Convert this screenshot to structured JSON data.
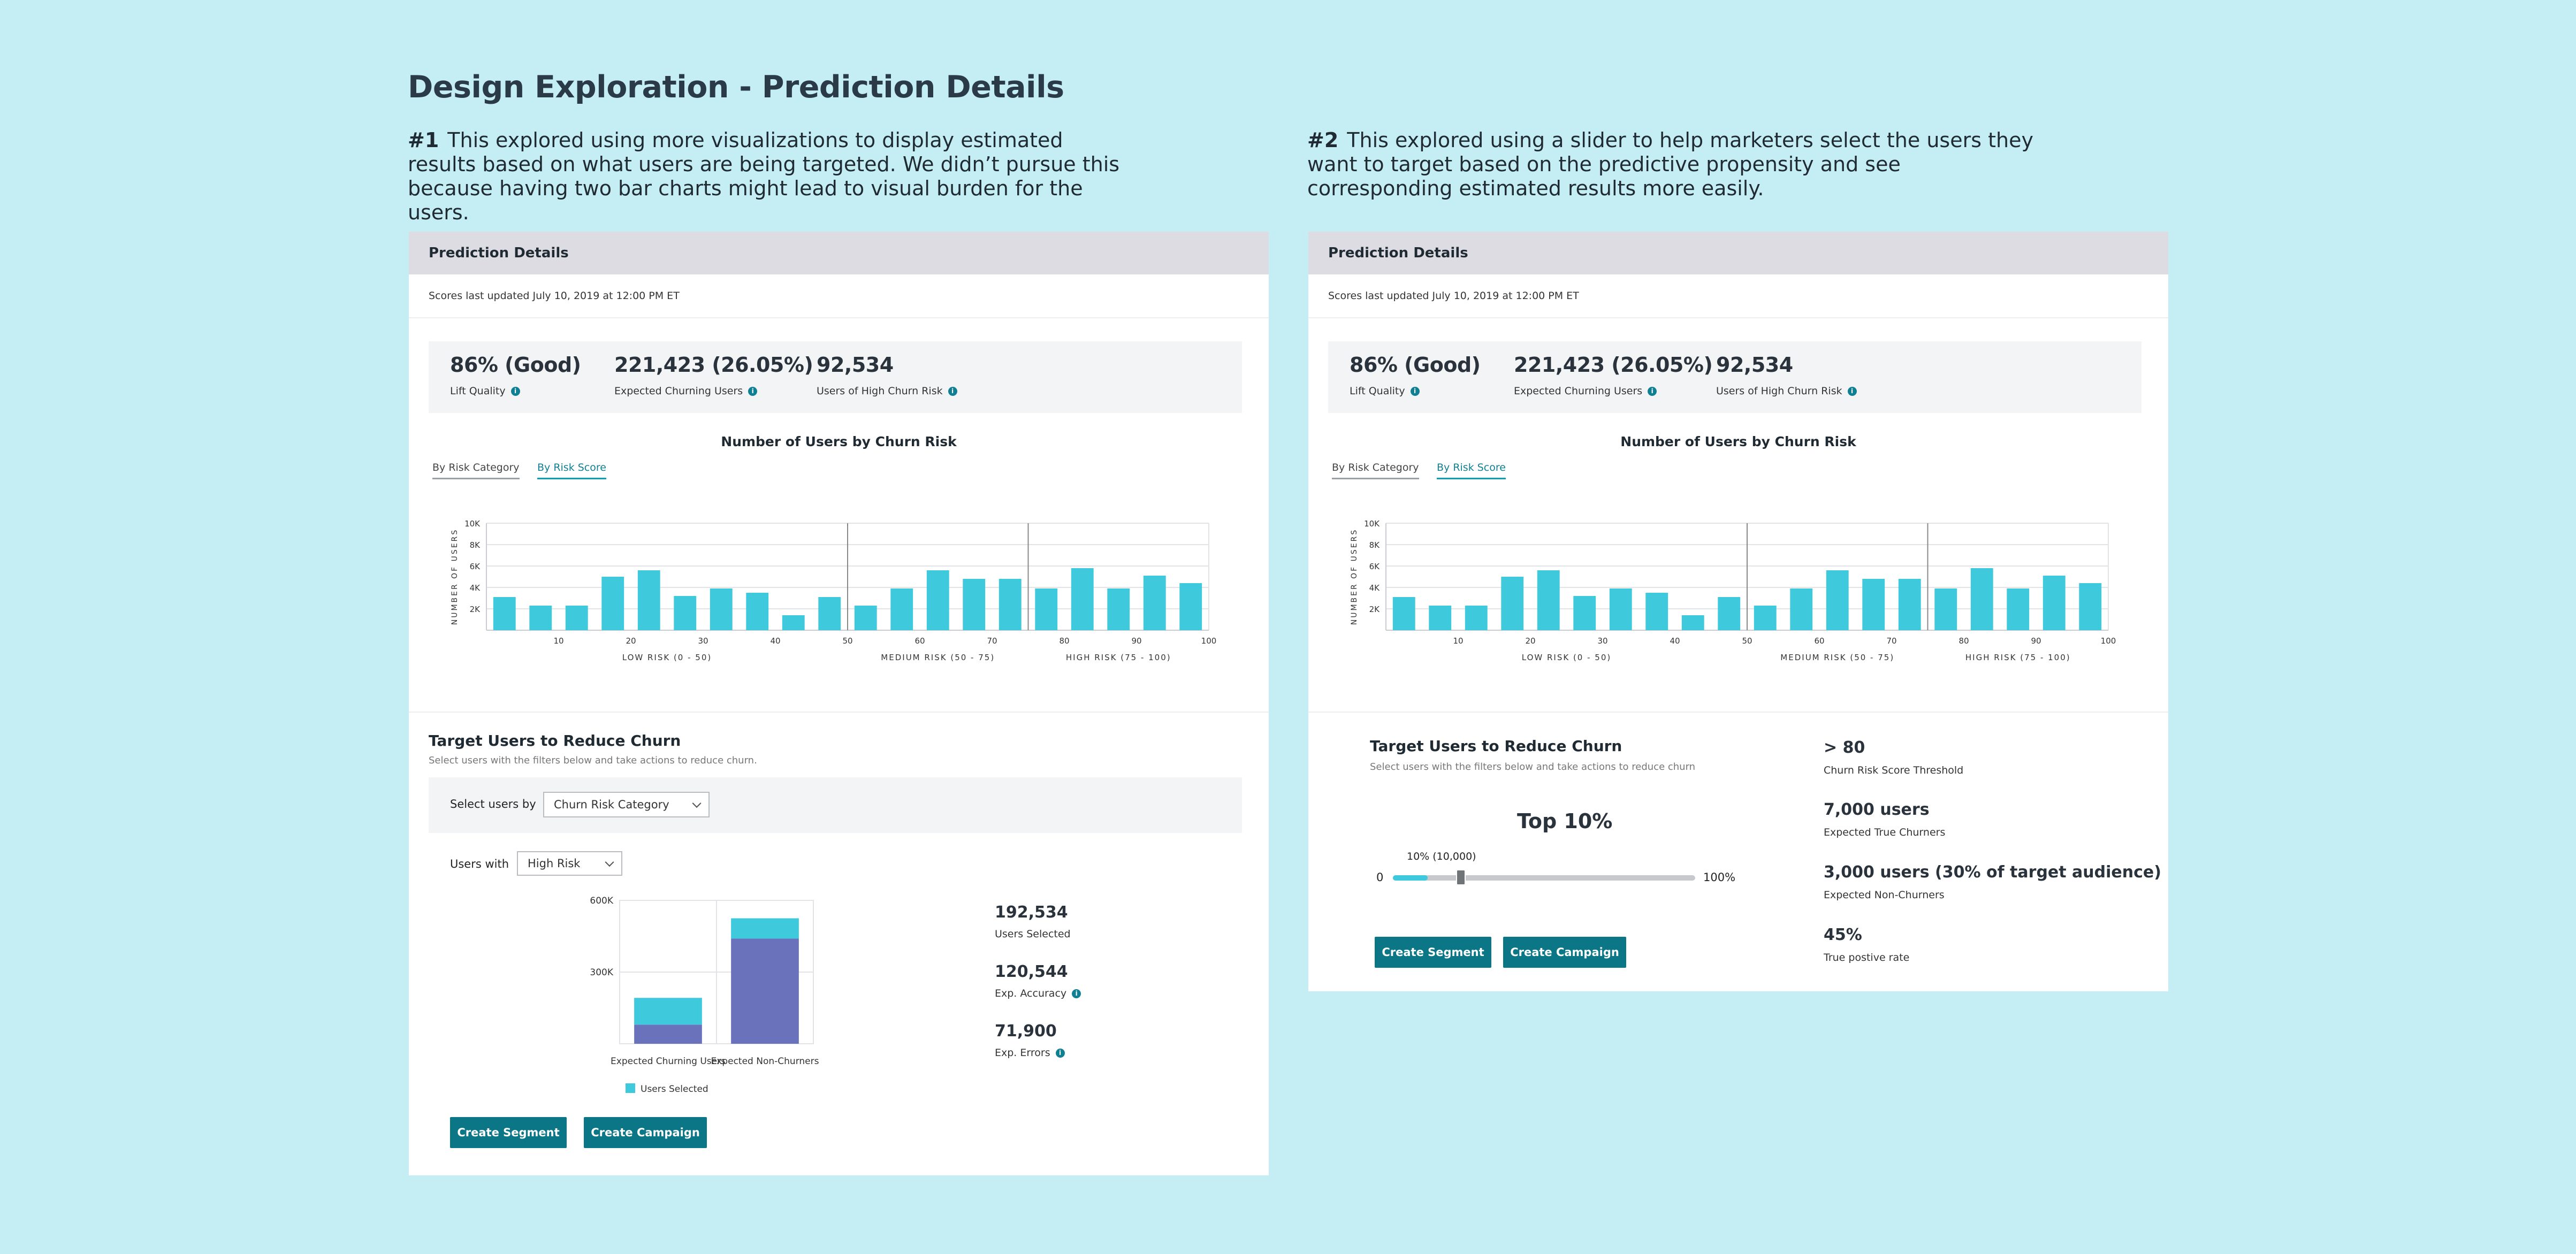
{
  "page": {
    "title": "Design Exploration - Prediction Details",
    "explorations": [
      {
        "number": "#1",
        "text": "This explored using more visualizations to display estimated results based on what users are being targeted. We didn’t pursue this because having two bar charts might lead to visual burden for the users."
      },
      {
        "number": "#2",
        "text": "This explored using a slider to help marketers select the users they want to target based on the predictive propensity and see corresponding estimated results more easily."
      }
    ]
  },
  "panel": {
    "header": "Prediction Details",
    "updated": "Scores last updated July 10, 2019 at 12:00 PM ET",
    "metrics": [
      {
        "value": "86% (Good)",
        "label": "Lift Quality"
      },
      {
        "value": "221,423 (26.05%)",
        "label": "Expected Churning Users"
      },
      {
        "value": "92,534",
        "label": "Users of High Churn Risk"
      }
    ],
    "tabs": [
      "By Risk Category",
      "By Risk Score"
    ],
    "info_icon": "i"
  },
  "chart_data": [
    {
      "type": "bar",
      "title": "Number of Users by Churn Risk",
      "ylabel": "NUMBER OF USERS",
      "ylim": [
        0,
        10000
      ],
      "yticks": [
        "2K",
        "4K",
        "6K",
        "8K",
        "10K"
      ],
      "xticks": [
        "10",
        "20",
        "30",
        "40",
        "50",
        "60",
        "70",
        "80",
        "90",
        "100"
      ],
      "categories": [
        "5",
        "10",
        "15",
        "20",
        "25",
        "30",
        "35",
        "40",
        "45",
        "50",
        "55",
        "60",
        "65",
        "70",
        "75",
        "80",
        "85",
        "90",
        "95",
        "100"
      ],
      "values": [
        3100,
        2300,
        2300,
        5000,
        5600,
        3200,
        3900,
        3500,
        1400,
        3100,
        2300,
        3900,
        5600,
        4800,
        4800,
        3900,
        5800,
        3900,
        5100,
        4400
      ],
      "segments": [
        "LOW RISK (0 - 50)",
        "MEDIUM RISK (50 - 75)",
        "HIGH RISK (75 - 100)"
      ],
      "color": "#3ec9dd"
    },
    {
      "type": "bar",
      "stacked": true,
      "categories": [
        "Expected Churning Users",
        "Expected Non-Churners"
      ],
      "series": [
        {
          "name": "",
          "values": [
            80000,
            440000
          ],
          "color": "#6a72bc"
        },
        {
          "name": "Users Selected",
          "values": [
            112000,
            85000
          ],
          "color": "#3ec9dd"
        }
      ],
      "ylim": [
        0,
        600000
      ],
      "yticks": [
        "300K",
        "600K"
      ]
    }
  ],
  "left": {
    "target": {
      "title": "Target Users to Reduce Churn",
      "subtitle": "Select users with the filters below and take actions to reduce churn.",
      "select_by_label": "Select users by",
      "select_by_value": "Churn Risk Category",
      "users_with_label": "Users with",
      "users_with_value": "High Risk"
    },
    "stats": [
      {
        "value": "192,534",
        "label": "Users Selected",
        "info": false
      },
      {
        "value": "120,544",
        "label": "Exp. Accuracy",
        "info": true
      },
      {
        "value": "71,900",
        "label": "Exp. Errors",
        "info": true
      }
    ],
    "buttons": {
      "segment": "Create Segment",
      "campaign": "Create Campaign"
    }
  },
  "right": {
    "target": {
      "title": "Target Users to Reduce Churn",
      "subtitle": "Select users with the filters below and take actions to reduce churn"
    },
    "slider": {
      "title": "Top 10%",
      "value_label": "10% (10,000)",
      "min_label": "0",
      "max_label": "100%",
      "value": 0.1
    },
    "stats": [
      {
        "value": "> 80",
        "label": "Churn Risk Score Threshold"
      },
      {
        "value": "7,000 users",
        "label": "Expected True Churners"
      },
      {
        "value": "3,000 users (30% of target audience)",
        "label": "Expected Non-Churners"
      },
      {
        "value": "45%",
        "label": "True postive rate"
      }
    ],
    "buttons": {
      "segment": "Create Segment",
      "campaign": "Create Campaign"
    }
  }
}
